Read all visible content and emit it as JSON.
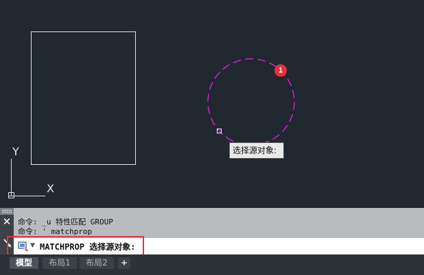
{
  "canvas": {
    "tooltip_text": "选择源对象:",
    "badge_number": "1",
    "ucs_y_label": "Y",
    "ucs_x_label": "X",
    "colors": {
      "background": "#212830",
      "rectangle": "#e6e6e6",
      "circle": "#d21fd2",
      "badge": "#e8313a"
    }
  },
  "command_panel": {
    "close_icon": "close-icon",
    "history": [
      "命令: _u 特性匹配 GROUP",
      "命令: ' matchprop"
    ],
    "input_text": "MATCHPROP 选择源对象:",
    "input_icon": "matchprop-brush-icon"
  },
  "tabs": [
    {
      "label": "模型",
      "active": true
    },
    {
      "label": "布局1",
      "active": false
    },
    {
      "label": "布局2",
      "active": false
    },
    {
      "label": "+",
      "active": false
    }
  ]
}
